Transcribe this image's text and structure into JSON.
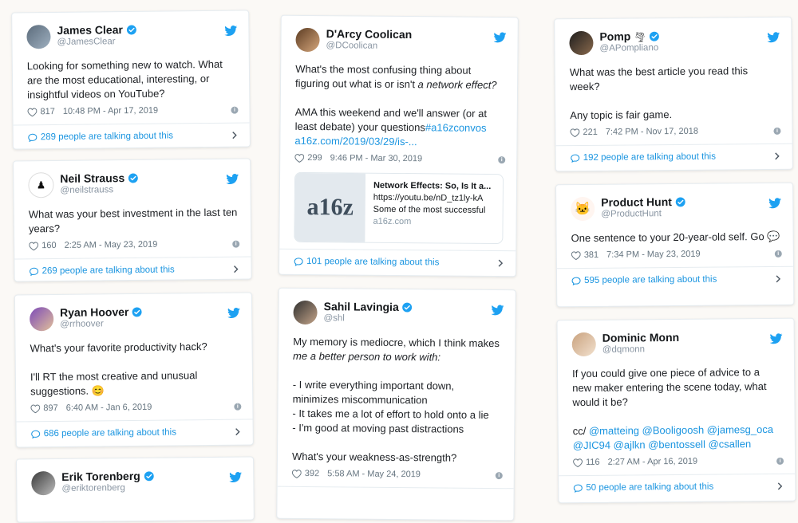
{
  "accent": "#1b95e0",
  "cards": {
    "james": {
      "name": "James Clear",
      "handle": "@JamesClear",
      "text": "Looking for something new to watch. What are the most educational, interesting, or insightful videos on YouTube?",
      "likes": "817",
      "time": "10:48 PM - Apr 17, 2019",
      "talking": "289 people are talking about this"
    },
    "neil": {
      "name": "Neil Strauss",
      "handle": "@neilstrauss",
      "text": "What was your best investment in the last ten years?",
      "likes": "160",
      "time": "2:25 AM - May 23, 2019",
      "talking": "269 people are talking about this"
    },
    "ryan": {
      "name": "Ryan Hoover",
      "handle": "@rrhoover",
      "line1": "What's your favorite productivity hack?",
      "line2": "I'll RT the most creative and unusual suggestions.",
      "emoji": "😊",
      "likes": "897",
      "time": "6:40 AM - Jan 6, 2019",
      "talking": "686 people are talking about this"
    },
    "erik": {
      "name": "Erik Torenberg",
      "handle": "@eriktorenberg"
    },
    "darcy": {
      "name": "D'Arcy Coolican",
      "handle": "@DCoolican",
      "line1a": "What's the most confusing thing about figuring out what is or isn't ",
      "line1b": "a network effect?",
      "line2": "AMA this weekend and we'll answer (or at least debate) your questions",
      "hashtag": "#a16zconvos",
      "url": "a16z.com/2019/03/29/is-...",
      "likes": "299",
      "time": "9:46 PM - Mar 30, 2019",
      "preview_logo": "a16z",
      "preview_title": "Network Effects: So, Is It a...",
      "preview_line": "https://youtu.be/nD_tz1ly-kA",
      "preview_desc": "Some of the most successful",
      "preview_domain": "a16z.com",
      "talking": "101 people are talking about this"
    },
    "sahil": {
      "name": "Sahil Lavingia",
      "handle": "@shl",
      "line1": "My memory is mediocre, which I think makes",
      "line1b": "me a better person to work with:",
      "b1": "- I write everything important down, minimizes miscommunication",
      "b2": "- It takes me a lot of effort to hold onto a lie",
      "b3": "- I'm good at moving past distractions",
      "line3": "What's your weakness-as-strength?",
      "likes": "392",
      "time": "5:58 AM - May 24, 2019"
    },
    "pomp": {
      "name": "Pomp",
      "handle": "@APompliano",
      "badge": "🌪",
      "line1": "What was the best article you read this week?",
      "line2": "Any topic is fair game.",
      "likes": "221",
      "time": "7:42 PM - Nov 17, 2018",
      "talking": "192 people are talking about this"
    },
    "ph": {
      "name": "Product Hunt",
      "handle": "@ProductHunt",
      "text": "One sentence to your 20-year-old self. Go",
      "emoji": "💬",
      "likes": "381",
      "time": "7:34 PM - May 23, 2019",
      "talking": "595 people are talking about this"
    },
    "dominic": {
      "name": "Dominic Monn",
      "handle": "@dqmonn",
      "line1": "If you could give one piece of advice to a new maker entering the scene today, what would it be?",
      "cc": "cc/ ",
      "mentions": "@matteing @Booligoosh @jamesg_oca @JIC94 @ajlkn @bentossell @csallen",
      "likes": "116",
      "time": "2:27 AM - Apr 16, 2019",
      "talking": "50 people are talking about this"
    }
  }
}
